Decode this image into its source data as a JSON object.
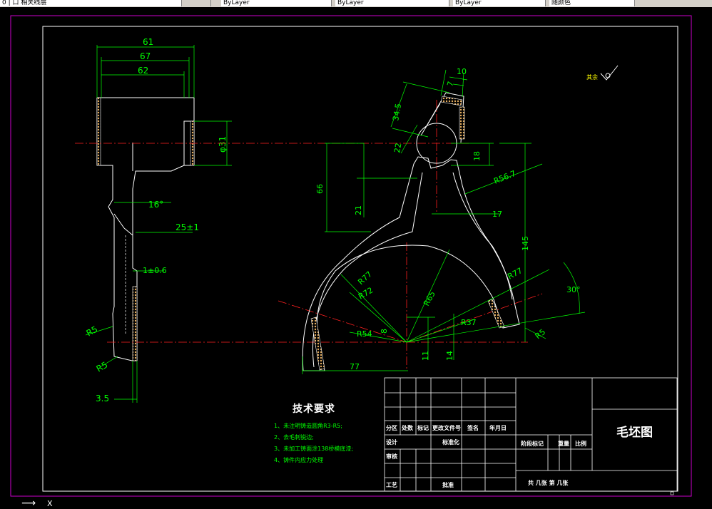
{
  "toolbar": {
    "layer_combo": "0   |   口   相关线层",
    "segments": [
      "ByLayer",
      "ByLayer",
      "ByLayer",
      "随颜色"
    ]
  },
  "drawing": {
    "dims_left": [
      "61",
      "67",
      "62",
      "φ31",
      "16°",
      "25±1",
      "1±0.6",
      "R5",
      "R5",
      "3.5"
    ],
    "dims_right": [
      "10",
      "7",
      "34.5",
      "22",
      "18",
      "R56.7",
      "66",
      "21",
      "17",
      "145",
      "R77",
      "R72",
      "R65",
      "R77",
      "30°",
      "R37",
      "R54",
      "8",
      "11",
      "14",
      "77",
      "R5"
    ],
    "roughness": "其余"
  },
  "tech": {
    "title": "技术要求",
    "items": [
      "1、未注明铸造圆角R3-R5;",
      "2、去毛刺锐边;",
      "3、未加工铸面涂138桥模底漆;",
      "4、铸件内应力处理"
    ]
  },
  "titleblock": {
    "headers": [
      "分区",
      "处数",
      "标记",
      "更改文件号",
      "签名",
      "年月日"
    ],
    "design": "设计",
    "standard": "标准化",
    "review": "审核",
    "process": "工艺",
    "approve": "批准",
    "stage": "阶段标记",
    "weight": "重量",
    "scale": "比例",
    "sheets": "共  几张  第  几张",
    "name": "毛坯图"
  },
  "status": {
    "arrow": "⟶",
    "axis": "X"
  }
}
